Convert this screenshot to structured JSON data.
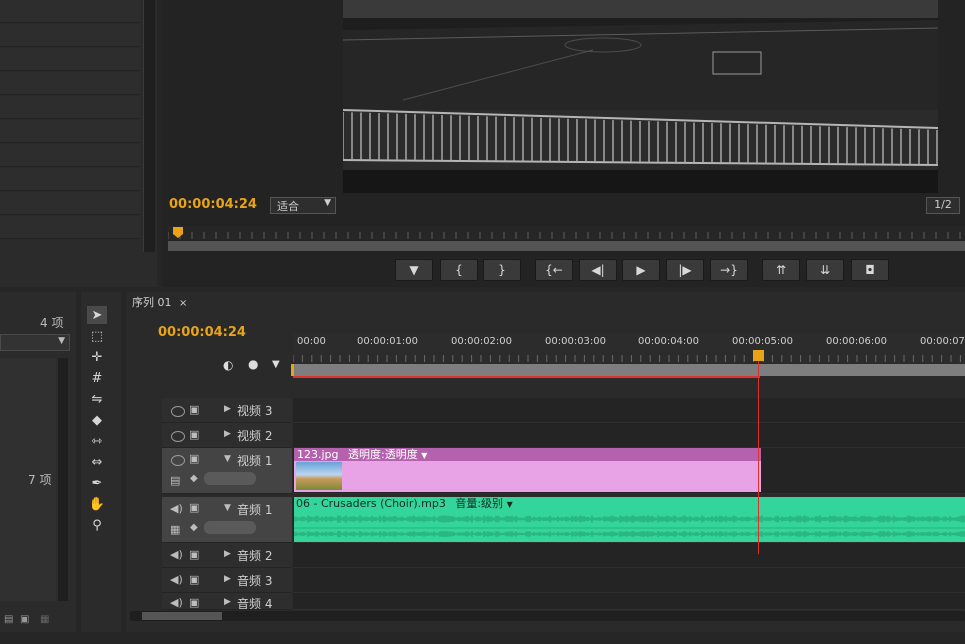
{
  "monitor": {
    "timecode": "00:00:04:24",
    "fit_label": "适合",
    "resolution": "1/2",
    "transport_buttons": [
      {
        "label": "▼",
        "icon": "add-marker-icon"
      },
      {
        "label": "{",
        "icon": "mark-in-icon"
      },
      {
        "label": "}",
        "icon": "mark-out-icon"
      },
      {
        "label": "{←",
        "icon": "go-to-in-icon"
      },
      {
        "label": "◀|",
        "icon": "step-back-icon"
      },
      {
        "label": "▶",
        "icon": "play-icon"
      },
      {
        "label": "|▶",
        "icon": "step-forward-icon"
      },
      {
        "label": "→}",
        "icon": "go-to-out-icon"
      },
      {
        "label": "⇈",
        "icon": "lift-icon"
      },
      {
        "label": "⇊",
        "icon": "extract-icon"
      },
      {
        "label": "◘",
        "icon": "export-frame-icon"
      }
    ]
  },
  "project": {
    "count_top": "4 项",
    "count_bottom": "7 项"
  },
  "timeline": {
    "tab_label": "序列 01",
    "timecode": "00:00:04:24",
    "ruler_labels": [
      "00:00",
      "00:00:01:00",
      "00:00:02:00",
      "00:00:03:00",
      "00:00:04:00",
      "00:00:05:00",
      "00:00:06:00",
      "00:00:07"
    ],
    "tracks": {
      "v3": "视频 3",
      "v2": "视频 2",
      "v1": "视频 1",
      "a1": "音频 1",
      "a2": "音频 2",
      "a3": "音频 3",
      "a4": "音频 4"
    },
    "video_clip": {
      "name": "123.jpg",
      "effect": "透明度:透明度"
    },
    "audio_clip": {
      "name": "06 - Crusaders (Choir).mp3",
      "effect": "音量:级别"
    }
  },
  "colors": {
    "accent": "#e8a317",
    "playhead": "#e0302b",
    "video_clip": "#e8a3e6",
    "audio_clip": "#33d59a"
  }
}
